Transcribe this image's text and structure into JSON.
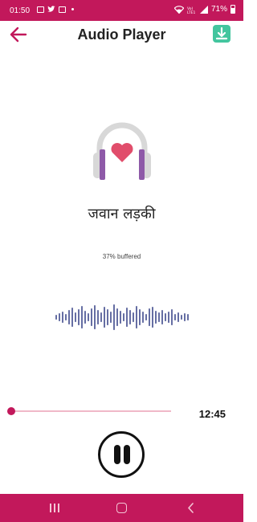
{
  "status_bar": {
    "time": "01:50",
    "battery": "71%",
    "left_icons": [
      "image-icon",
      "twitter-icon",
      "card-icon",
      "dot-icon"
    ],
    "right_icons": [
      "wifi-icon",
      "volte-icon",
      "signal-icon",
      "battery-icon"
    ],
    "color": "#c2185b"
  },
  "app_bar": {
    "title": "Audio Player",
    "back_icon": "arrow-left-icon",
    "download_icon": "download-icon",
    "accent_color": "#c2185b",
    "download_color": "#43c59e"
  },
  "player": {
    "artwork_icon": "headphone-heart-icon",
    "track_title": "जवान लड़की",
    "buffer_status": "37% buffered",
    "progress_fraction": 0.0,
    "duration": "12:45",
    "control_state": "pause-icon",
    "waveform_color": "#3f4a8c"
  },
  "nav_bar": {
    "items": [
      "recents-icon",
      "home-icon",
      "back-icon"
    ]
  }
}
